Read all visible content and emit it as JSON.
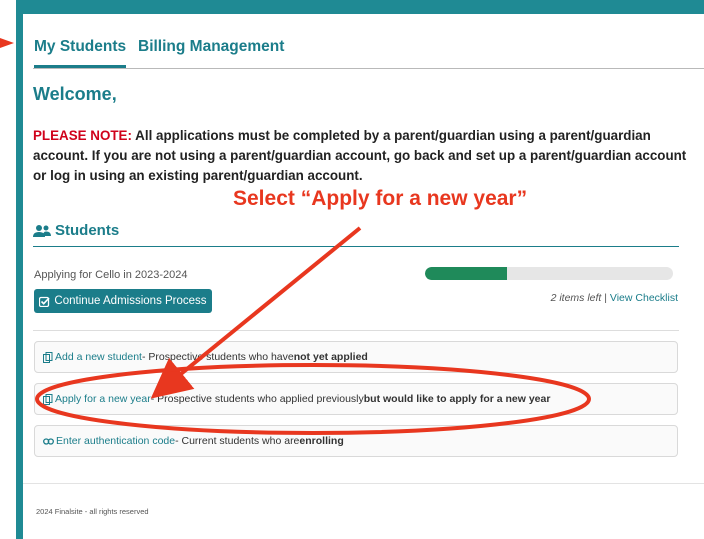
{
  "tabs": [
    {
      "label": "My Students",
      "active": true
    },
    {
      "label": "Billing Management",
      "active": false
    }
  ],
  "welcome": "Welcome,",
  "note": {
    "label": "PLEASE NOTE:",
    "text": " All applications must be completed by a parent/guardian using a parent/guardian account. If you are not using a parent/guardian account, go back and set up a parent/guardian account or log in using an existing parent/guardian account."
  },
  "students": {
    "title": "Students",
    "icon": "users-icon",
    "applying": "Applying for Cello in 2023-2024",
    "progress": 0.33,
    "continue_button": "Continue Admissions Process",
    "items_left": "2 items left",
    "separator": " | ",
    "view_checklist": "View Checklist"
  },
  "options": [
    {
      "link": "Add a new student",
      "text": " - Prospective students who have ",
      "bold": "not yet applied",
      "icon": "copy-icon"
    },
    {
      "link": "Apply for a new year",
      "text": " - Prospective students who applied previously ",
      "bold": "but would like to apply for a new year",
      "icon": "copy-icon"
    },
    {
      "link": "Enter authentication code",
      "text": " - Current students who are ",
      "bold": "enrolling",
      "icon": "link-icon"
    }
  ],
  "footer": "2024 Finalsite - all rights reserved",
  "annotation": "Select “Apply for a new year”",
  "colors": {
    "accent": "#1b7d8a",
    "frame": "#1f8a94",
    "annotation": "#e8371f",
    "progress": "#1f8a5a",
    "note_label": "#d0021b"
  }
}
